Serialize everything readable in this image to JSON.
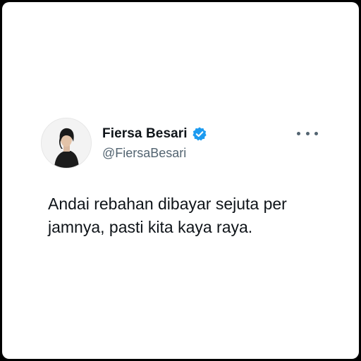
{
  "tweet": {
    "display_name": "Fiersa Besari",
    "handle": "@FiersaBesari",
    "text_line1": "Andai rebahan dibayar sejuta per",
    "text_line2": "jamnya, pasti kita kaya raya.",
    "verified": true
  },
  "icons": {
    "verified": "verified-badge-icon",
    "more": "more-options-icon",
    "avatar": "profile-photo"
  },
  "colors": {
    "background": "#ffffff",
    "frame": "#000000",
    "name_text": "#0f1419",
    "handle_text": "#536471",
    "verified_blue": "#1d9bf0"
  }
}
